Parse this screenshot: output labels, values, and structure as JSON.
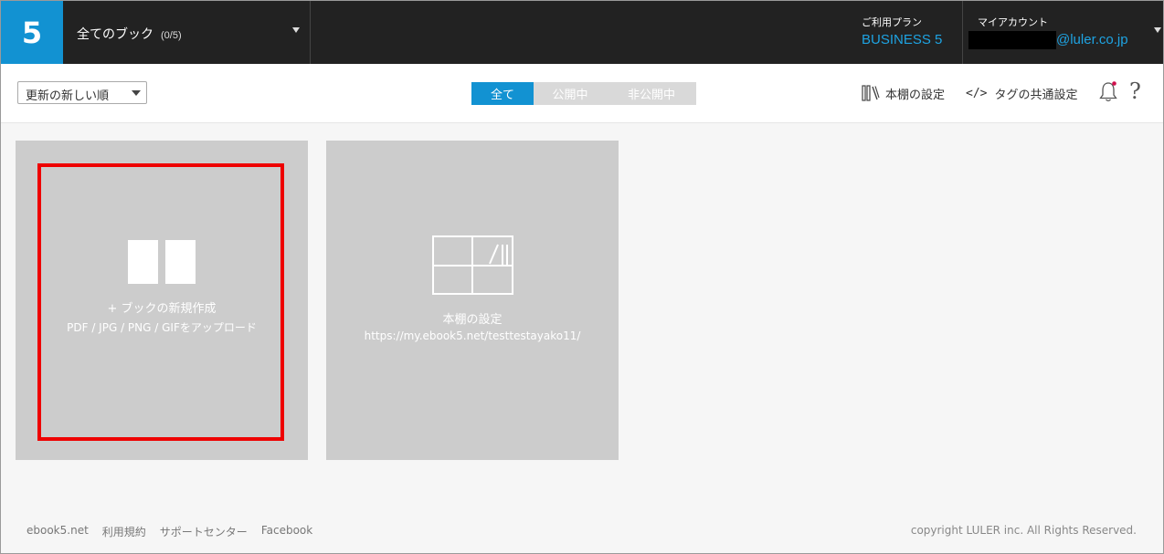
{
  "header": {
    "logo": "5",
    "book_select_title": "全てのブック",
    "book_select_count": "(0/5)",
    "plan_label": "ご利用プラン",
    "plan_value": "BUSINESS 5",
    "account_label": "マイアカウント",
    "account_email_visible": "@luler.co.jp"
  },
  "toolbar": {
    "sort_selected": "更新の新しい順",
    "filter_tabs": [
      {
        "label": "全て",
        "active": true
      },
      {
        "label": "公開中",
        "active": false
      },
      {
        "label": "非公開中",
        "active": false
      }
    ],
    "shelf_setting_label": "本棚の設定",
    "tag_setting_code": "</>",
    "tag_setting_label": "タグの共通設定",
    "help_symbol": "?"
  },
  "cards": {
    "new_book": {
      "title": "+ ブックの新規作成",
      "subtitle": "PDF / JPG / PNG / GIFをアップロード",
      "icon": "open-book-icon"
    },
    "shelf": {
      "title": "本棚の設定",
      "subtitle": "https://my.ebook5.net/testtestayako11/",
      "icon": "bookshelf-icon"
    }
  },
  "footer": {
    "links": [
      "ebook5.net",
      "利用規約",
      "サポートセンター",
      "Facebook"
    ],
    "copyright": "copyright LULER inc. All Rights Reserved."
  },
  "colors": {
    "header_bg": "#222222",
    "accent": "#1292d2",
    "link_blue": "#1ea3e2",
    "card_bg": "#cccccc",
    "highlight_red": "#ee0000",
    "notification_dot": "#d0104c"
  }
}
